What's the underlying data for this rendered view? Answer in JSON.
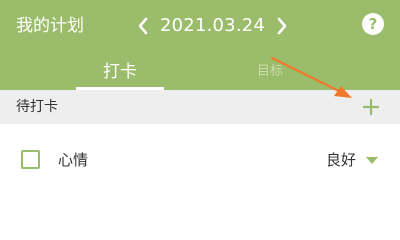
{
  "header": {
    "title": "我的计划",
    "date": "2021.03.24",
    "prev_icon": "chevron-left-icon",
    "next_icon": "chevron-right-icon",
    "help_icon": "help-icon",
    "help_glyph": "?"
  },
  "tabs": [
    {
      "label": "打卡",
      "active": true
    },
    {
      "label": "目标",
      "active": false
    }
  ],
  "section": {
    "title": "待打卡",
    "add_icon": "plus-icon"
  },
  "items": [
    {
      "label": "心情",
      "checked": false,
      "status": "良好",
      "status_icon": "dropdown-triangle-icon"
    }
  ],
  "annotation": {
    "icon": "arrow-annotation-icon",
    "color": "#f07a2a"
  },
  "colors": {
    "accent": "#9bbc6a",
    "section_bg": "#eeeeee",
    "text": "#333333"
  }
}
